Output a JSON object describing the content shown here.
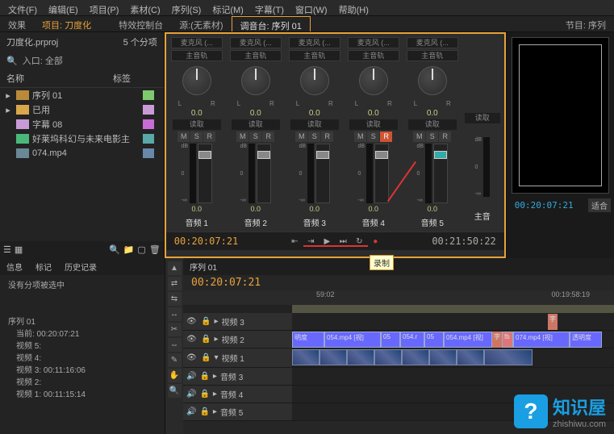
{
  "menu": {
    "file": "文件(F)",
    "edit": "编辑(E)",
    "project": "项目(P)",
    "clip": "素材(C)",
    "sequence": "序列(S)",
    "marker": "标记(M)",
    "title": "字幕(T)",
    "window": "窗口(W)",
    "help": "帮助(H)"
  },
  "strip": {
    "fx": "效果",
    "projActive": "项目: 刀度化",
    "fxctrl": "特效控制台",
    "src": "源:(无素材)",
    "mixer": "调音台: 序列 01",
    "program": "节目: 序列"
  },
  "project": {
    "filename": "刀度化.prproj",
    "count": "5 个分项",
    "entrance": "入口: 全部",
    "col_name": "名称",
    "col_label": "标签",
    "items": [
      {
        "icon": "#b88a3a",
        "label": "序列 01",
        "swatch": "#7ecb6e",
        "type": "seq"
      },
      {
        "icon": "#d9a84a",
        "label": "已用",
        "swatch": "#c99bd6",
        "type": "folder"
      },
      {
        "icon": "#c99bd6",
        "label": "字幕 08",
        "swatch": "#c96bd6",
        "type": "title"
      },
      {
        "icon": "#4ab87a",
        "label": "好莱坞科幻与未来电影主",
        "swatch": "#5aa8a8",
        "type": "audio"
      },
      {
        "icon": "#6a8895",
        "label": "074.mp4",
        "swatch": "#6888aa",
        "type": "video"
      }
    ]
  },
  "mixer": {
    "inputLabel": "麦克风 (...",
    "masterLabel": "主音轨",
    "knobVal": "0.0",
    "readLabel": "读取",
    "scaleTop": "dB",
    "scale0": "0",
    "faderVal": "0.0",
    "channels": [
      "音频 1",
      "音频 2",
      "音频 3",
      "音频 4",
      "音频 5"
    ],
    "master": "主音",
    "leftTC": "00:20:07:21",
    "rightTC": "00:21:50:22",
    "recordLabel": "录制"
  },
  "preview": {
    "tab": "节目: 序列",
    "tc": "00:20:07:21",
    "fit": "适合"
  },
  "info": {
    "tabs": {
      "info": "信息",
      "marker": "标记",
      "history": "历史记录"
    },
    "noSelection": "没有分项被选中",
    "seqLabel": "序列 01",
    "current": "当前: 00:20:07:21",
    "v5": "视频 5:",
    "v4": "视频 4:",
    "v2": "视频 2:",
    "v3": "视频 3: 00:11:16:06",
    "v1": "视频 1: 00:11:15:14"
  },
  "timeline": {
    "tab": "序列 01",
    "tc": "00:20:07:21",
    "times": [
      "59:02",
      "00:19:58:19"
    ],
    "vtracks": [
      "视频 3",
      "视频 2",
      "视频 1"
    ],
    "atracks": [
      "音频 3",
      "音频 4",
      "音频 5"
    ],
    "clips": {
      "opacity": "明度",
      "c054": "054.mp4 [视]",
      "c074": "074.mp4 [视]",
      "trans": "透明度",
      "caption": "字"
    }
  },
  "watermark": {
    "title": "知识屋",
    "url": "zhishiwu.com"
  }
}
